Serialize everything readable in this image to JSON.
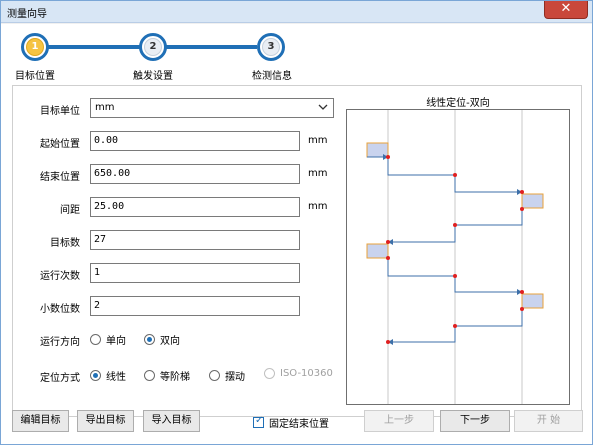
{
  "window": {
    "title": "测量向导",
    "close_glyph": "✕"
  },
  "steps": [
    {
      "number": "1",
      "label": "目标位置",
      "active": true
    },
    {
      "number": "2",
      "label": "触发设置",
      "active": false
    },
    {
      "number": "3",
      "label": "检测信息",
      "active": false
    }
  ],
  "form": {
    "target_unit": {
      "label": "目标单位",
      "value": "mm"
    },
    "start_pos": {
      "label": "起始位置",
      "value": "0.00",
      "unit": "mm"
    },
    "end_pos": {
      "label": "结束位置",
      "value": "650.00",
      "unit": "mm"
    },
    "spacing": {
      "label": "间距",
      "value": "25.00",
      "unit": "mm"
    },
    "target_count": {
      "label": "目标数",
      "value": "27"
    },
    "run_count": {
      "label": "运行次数",
      "value": "1"
    },
    "decimals": {
      "label": "小数位数",
      "value": "2"
    },
    "direction": {
      "label": "运行方向",
      "options": [
        "单向",
        "双向"
      ],
      "selected": "双向"
    },
    "positioning": {
      "label": "定位方式",
      "options": [
        "线性",
        "等阶梯",
        "摆动",
        "ISO-10360"
      ],
      "selected": "线性",
      "disabled": [
        "ISO-10360"
      ]
    }
  },
  "chart": {
    "title": "线性定位-双向"
  },
  "footer": {
    "edit_target": "编辑目标",
    "export_target": "导出目标",
    "import_target": "导入目标",
    "fix_end": "固定结束位置",
    "prev": "上一步",
    "next": "下一步",
    "start": "开 始"
  },
  "colors": {
    "accent": "#1f6fb6",
    "marker": "#e02020",
    "block_fill": "#c9d3ee",
    "block_border": "#e8a13a"
  }
}
